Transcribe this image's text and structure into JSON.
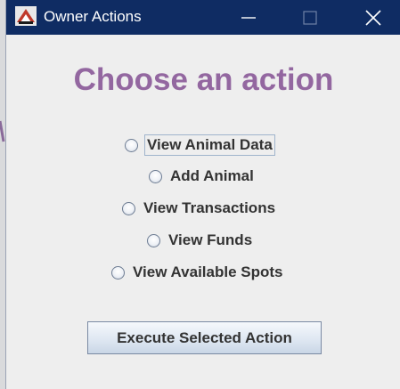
{
  "window": {
    "title": "Owner Actions",
    "titlebar_color": "#0f2c63",
    "icons": {
      "app": "app-logo-icon",
      "minimize": "minimize-icon",
      "maximize": "maximize-icon",
      "close": "close-icon"
    }
  },
  "heading": {
    "text": "Choose an action",
    "color": "#9367a0"
  },
  "options": [
    {
      "label": "View Animal Data",
      "selected": false,
      "focused": true
    },
    {
      "label": "Add Animal",
      "selected": false,
      "focused": false
    },
    {
      "label": "View Transactions",
      "selected": false,
      "focused": false
    },
    {
      "label": "View Funds",
      "selected": false,
      "focused": false
    },
    {
      "label": "View Available Spots",
      "selected": false,
      "focused": false
    }
  ],
  "execute_button": {
    "label": "Execute Selected Action"
  }
}
